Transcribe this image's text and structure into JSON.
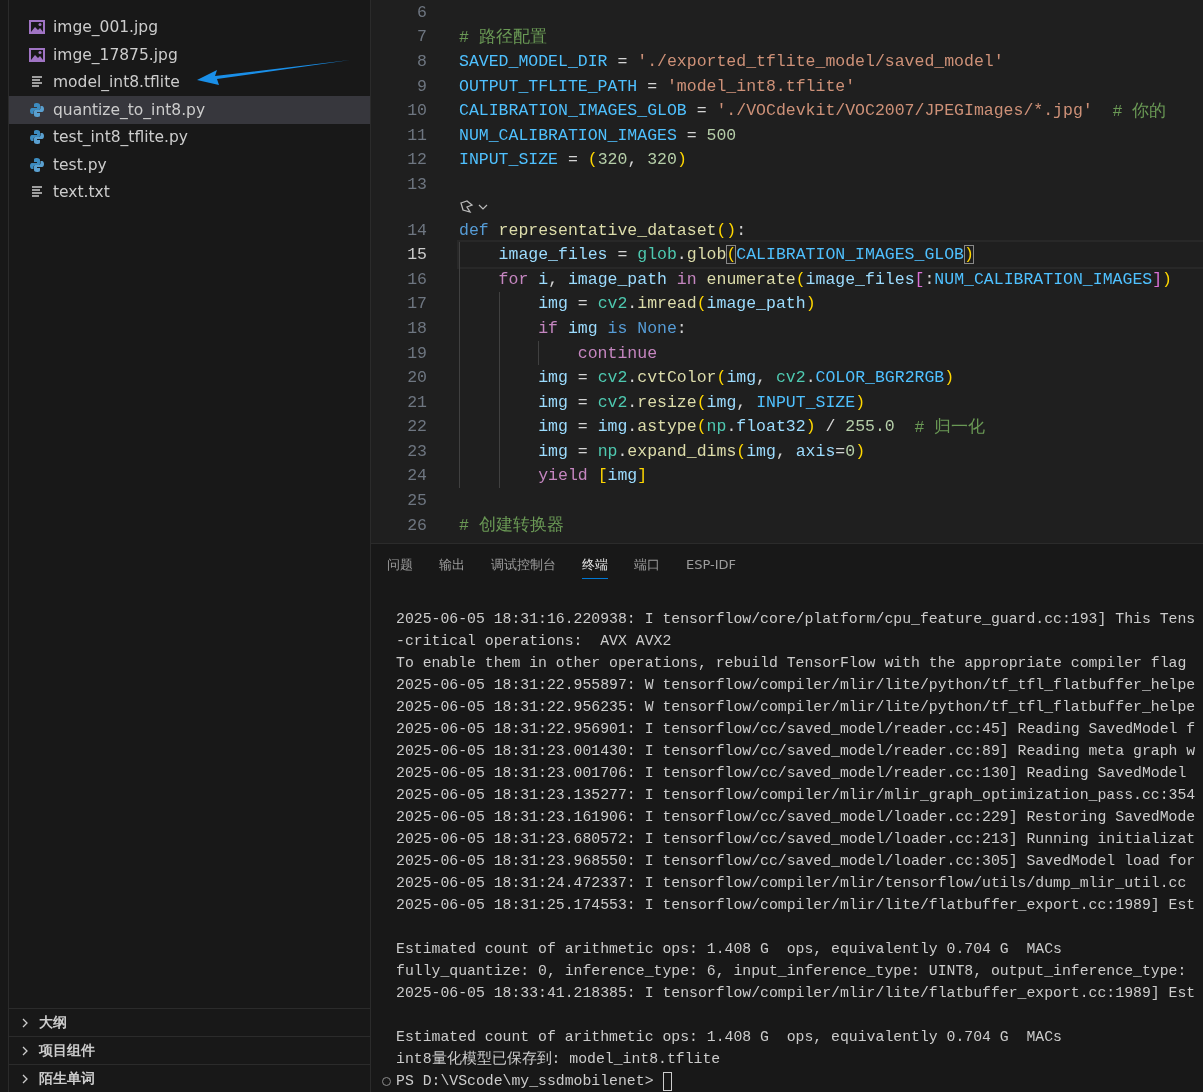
{
  "explorer": {
    "files": [
      {
        "name": "imge_001.jpg",
        "kind": "image",
        "selected": false
      },
      {
        "name": "imge_17875.jpg",
        "kind": "image",
        "selected": false
      },
      {
        "name": "model_int8.tflite",
        "kind": "text",
        "selected": false
      },
      {
        "name": "quantize_to_int8.py",
        "kind": "python",
        "selected": true
      },
      {
        "name": "test_int8_tflite.py",
        "kind": "python",
        "selected": false
      },
      {
        "name": "test.py",
        "kind": "python",
        "selected": false
      },
      {
        "name": "text.txt",
        "kind": "text",
        "selected": false
      }
    ],
    "sections": [
      {
        "label": "大纲",
        "expanded": false
      },
      {
        "label": "项目组件",
        "expanded": false
      },
      {
        "label": "陌生单词",
        "expanded": false
      }
    ]
  },
  "editor": {
    "lines": [
      {
        "kind": "code",
        "number": "6",
        "selected": false
      },
      {
        "kind": "code",
        "number": "7",
        "selected": false,
        "tokens": [
          {
            "kind": "com",
            "text": "# 路径配置"
          }
        ]
      },
      {
        "kind": "code",
        "number": "8",
        "selected": false,
        "tokens": [
          {
            "kind": "var",
            "text": "SAVED_MODEL_DIR"
          },
          {
            "kind": "op",
            "text": " = "
          },
          {
            "kind": "str",
            "text": "'./exported_tflite_model/saved_model'"
          }
        ]
      },
      {
        "kind": "code",
        "number": "9",
        "selected": false,
        "tokens": [
          {
            "kind": "var",
            "text": "OUTPUT_TFLITE_PATH"
          },
          {
            "kind": "op",
            "text": " = "
          },
          {
            "kind": "str",
            "text": "'model_int8.tflite'"
          }
        ]
      },
      {
        "kind": "code",
        "number": "10",
        "selected": false,
        "tokens": [
          {
            "kind": "var",
            "text": "CALIBRATION_IMAGES_GLOB"
          },
          {
            "kind": "op",
            "text": " = "
          },
          {
            "kind": "str",
            "text": "'./VOCdevkit/VOC2007/JPEGImages/*.jpg'"
          },
          {
            "kind": "com",
            "text": "  # 你的"
          }
        ]
      },
      {
        "kind": "code",
        "number": "11",
        "selected": false,
        "tokens": [
          {
            "kind": "var",
            "text": "NUM_CALIBRATION_IMAGES"
          },
          {
            "kind": "op",
            "text": " = "
          },
          {
            "kind": "num",
            "text": "500"
          }
        ]
      },
      {
        "kind": "code",
        "number": "12",
        "selected": false,
        "tokens": [
          {
            "kind": "var",
            "text": "INPUT_SIZE"
          },
          {
            "kind": "op",
            "text": " = "
          },
          {
            "kind": "br1",
            "text": "("
          },
          {
            "kind": "num",
            "text": "320"
          },
          {
            "kind": "op",
            "text": ", "
          },
          {
            "kind": "num",
            "text": "320"
          },
          {
            "kind": "br1",
            "text": ")"
          }
        ]
      },
      {
        "kind": "code",
        "number": "13",
        "selected": false
      },
      {
        "kind": "codelens"
      },
      {
        "kind": "code",
        "number": "14",
        "selected": false,
        "tokens": [
          {
            "kind": "kw",
            "text": "def "
          },
          {
            "kind": "fn",
            "text": "representative_dataset"
          },
          {
            "kind": "br1",
            "text": "()"
          },
          {
            "kind": "op",
            "text": ":"
          }
        ]
      },
      {
        "kind": "code",
        "number": "15",
        "selected": true,
        "tokens": [
          {
            "kind": "id",
            "text": "    image_files"
          },
          {
            "kind": "op",
            "text": " = "
          },
          {
            "kind": "mod",
            "text": "glob"
          },
          {
            "kind": "op",
            "text": "."
          },
          {
            "kind": "fn",
            "text": "glob"
          },
          {
            "kind": "brm",
            "text": "("
          },
          {
            "kind": "var",
            "text": "CALIBRATION_IMAGES_GLOB"
          },
          {
            "kind": "brm",
            "text": ")"
          }
        ]
      },
      {
        "kind": "code",
        "number": "16",
        "selected": false,
        "tokens": [
          {
            "kind": "ctrl",
            "text": "    for "
          },
          {
            "kind": "id",
            "text": "i"
          },
          {
            "kind": "op",
            "text": ", "
          },
          {
            "kind": "id",
            "text": "image_path "
          },
          {
            "kind": "ctrl",
            "text": "in "
          },
          {
            "kind": "fn",
            "text": "enumerate"
          },
          {
            "kind": "br1",
            "text": "("
          },
          {
            "kind": "id",
            "text": "image_files"
          },
          {
            "kind": "br2",
            "text": "["
          },
          {
            "kind": "op",
            "text": ":"
          },
          {
            "kind": "var",
            "text": "NUM_CALIBRATION_IMAGES"
          },
          {
            "kind": "br2",
            "text": "]"
          },
          {
            "kind": "br1",
            "text": ")"
          }
        ]
      },
      {
        "kind": "code",
        "number": "17",
        "selected": false,
        "tokens": [
          {
            "kind": "id",
            "text": "        img"
          },
          {
            "kind": "op",
            "text": " = "
          },
          {
            "kind": "mod",
            "text": "cv2"
          },
          {
            "kind": "op",
            "text": "."
          },
          {
            "kind": "fn",
            "text": "imread"
          },
          {
            "kind": "br1",
            "text": "("
          },
          {
            "kind": "id",
            "text": "image_path"
          },
          {
            "kind": "br1",
            "text": ")"
          }
        ]
      },
      {
        "kind": "code",
        "number": "18",
        "selected": false,
        "tokens": [
          {
            "kind": "ctrl",
            "text": "        if "
          },
          {
            "kind": "id",
            "text": "img "
          },
          {
            "kind": "kw",
            "text": "is "
          },
          {
            "kind": "kw",
            "text": "None"
          },
          {
            "kind": "op",
            "text": ":"
          }
        ]
      },
      {
        "kind": "code",
        "number": "19",
        "selected": false,
        "tokens": [
          {
            "kind": "ctrl",
            "text": "            continue"
          }
        ]
      },
      {
        "kind": "code",
        "number": "20",
        "selected": false,
        "tokens": [
          {
            "kind": "id",
            "text": "        img"
          },
          {
            "kind": "op",
            "text": " = "
          },
          {
            "kind": "mod",
            "text": "cv2"
          },
          {
            "kind": "op",
            "text": "."
          },
          {
            "kind": "fn",
            "text": "cvtColor"
          },
          {
            "kind": "br1",
            "text": "("
          },
          {
            "kind": "id",
            "text": "img"
          },
          {
            "kind": "op",
            "text": ", "
          },
          {
            "kind": "mod",
            "text": "cv2"
          },
          {
            "kind": "op",
            "text": "."
          },
          {
            "kind": "var",
            "text": "COLOR_BGR2RGB"
          },
          {
            "kind": "br1",
            "text": ")"
          }
        ]
      },
      {
        "kind": "code",
        "number": "21",
        "selected": false,
        "tokens": [
          {
            "kind": "id",
            "text": "        img"
          },
          {
            "kind": "op",
            "text": " = "
          },
          {
            "kind": "mod",
            "text": "cv2"
          },
          {
            "kind": "op",
            "text": "."
          },
          {
            "kind": "fn",
            "text": "resize"
          },
          {
            "kind": "br1",
            "text": "("
          },
          {
            "kind": "id",
            "text": "img"
          },
          {
            "kind": "op",
            "text": ", "
          },
          {
            "kind": "var",
            "text": "INPUT_SIZE"
          },
          {
            "kind": "br1",
            "text": ")"
          }
        ]
      },
      {
        "kind": "code",
        "number": "22",
        "selected": false,
        "tokens": [
          {
            "kind": "id",
            "text": "        img"
          },
          {
            "kind": "op",
            "text": " = "
          },
          {
            "kind": "id",
            "text": "img"
          },
          {
            "kind": "op",
            "text": "."
          },
          {
            "kind": "fn",
            "text": "astype"
          },
          {
            "kind": "br1",
            "text": "("
          },
          {
            "kind": "mod",
            "text": "np"
          },
          {
            "kind": "op",
            "text": "."
          },
          {
            "kind": "id",
            "text": "float32"
          },
          {
            "kind": "br1",
            "text": ")"
          },
          {
            "kind": "op",
            "text": " / "
          },
          {
            "kind": "num",
            "text": "255.0"
          },
          {
            "kind": "com",
            "text": "  # 归一化"
          }
        ]
      },
      {
        "kind": "code",
        "number": "23",
        "selected": false,
        "tokens": [
          {
            "kind": "id",
            "text": "        img"
          },
          {
            "kind": "op",
            "text": " = "
          },
          {
            "kind": "mod",
            "text": "np"
          },
          {
            "kind": "op",
            "text": "."
          },
          {
            "kind": "fn",
            "text": "expand_dims"
          },
          {
            "kind": "br1",
            "text": "("
          },
          {
            "kind": "id",
            "text": "img"
          },
          {
            "kind": "op",
            "text": ", "
          },
          {
            "kind": "id",
            "text": "axis"
          },
          {
            "kind": "op",
            "text": "="
          },
          {
            "kind": "num",
            "text": "0"
          },
          {
            "kind": "br1",
            "text": ")"
          }
        ]
      },
      {
        "kind": "code",
        "number": "24",
        "selected": false,
        "tokens": [
          {
            "kind": "ctrl",
            "text": "        yield "
          },
          {
            "kind": "br1",
            "text": "["
          },
          {
            "kind": "id",
            "text": "img"
          },
          {
            "kind": "br1",
            "text": "]"
          }
        ]
      },
      {
        "kind": "code",
        "number": "25",
        "selected": false
      },
      {
        "kind": "code",
        "number": "26",
        "selected": false,
        "tokens": [
          {
            "kind": "com",
            "text": "# 创建转换器"
          }
        ]
      }
    ]
  },
  "panel": {
    "tabs": [
      {
        "label": "问题",
        "selected": false
      },
      {
        "label": "输出",
        "selected": false
      },
      {
        "label": "调试控制台",
        "selected": false
      },
      {
        "label": "终端",
        "selected": true
      },
      {
        "label": "端口",
        "selected": false
      },
      {
        "label": "ESP-IDF",
        "selected": false
      }
    ],
    "terminal": {
      "blocks": [
        [
          "2025-06-05 18:31:16.220938: I tensorflow/core/platform/cpu_feature_guard.cc:193] This Tens",
          "-critical operations:  AVX AVX2",
          "To enable them in other operations, rebuild TensorFlow with the appropriate compiler flag",
          "2025-06-05 18:31:22.955897: W tensorflow/compiler/mlir/lite/python/tf_tfl_flatbuffer_helpe",
          "2025-06-05 18:31:22.956235: W tensorflow/compiler/mlir/lite/python/tf_tfl_flatbuffer_helpe",
          "2025-06-05 18:31:22.956901: I tensorflow/cc/saved_model/reader.cc:45] Reading SavedModel f",
          "2025-06-05 18:31:23.001430: I tensorflow/cc/saved_model/reader.cc:89] Reading meta graph w",
          "2025-06-05 18:31:23.001706: I tensorflow/cc/saved_model/reader.cc:130] Reading SavedModel",
          "2025-06-05 18:31:23.135277: I tensorflow/compiler/mlir/mlir_graph_optimization_pass.cc:354",
          "2025-06-05 18:31:23.161906: I tensorflow/cc/saved_model/loader.cc:229] Restoring SavedMode",
          "2025-06-05 18:31:23.680572: I tensorflow/cc/saved_model/loader.cc:213] Running initializat",
          "2025-06-05 18:31:23.968550: I tensorflow/cc/saved_model/loader.cc:305] SavedModel load for",
          "2025-06-05 18:31:24.472337: I tensorflow/compiler/mlir/tensorflow/utils/dump_mlir_util.cc",
          "2025-06-05 18:31:25.174553: I tensorflow/compiler/mlir/lite/flatbuffer_export.cc:1989] Est"
        ],
        [
          "Estimated count of arithmetic ops: 1.408 G  ops, equivalently 0.704 G  MACs",
          "fully_quantize: 0, inference_type: 6, input_inference_type: UINT8, output_inference_type:",
          "2025-06-05 18:33:41.218385: I tensorflow/compiler/mlir/lite/flatbuffer_export.cc:1989] Est"
        ],
        [
          "Estimated count of arithmetic ops: 1.408 G  ops, equivalently 0.704 G  MACs",
          "int8量化模型已保存到: model_int8.tflite"
        ]
      ],
      "prompt": "PS D:\\VScode\\my_ssdmobilenet>"
    }
  }
}
